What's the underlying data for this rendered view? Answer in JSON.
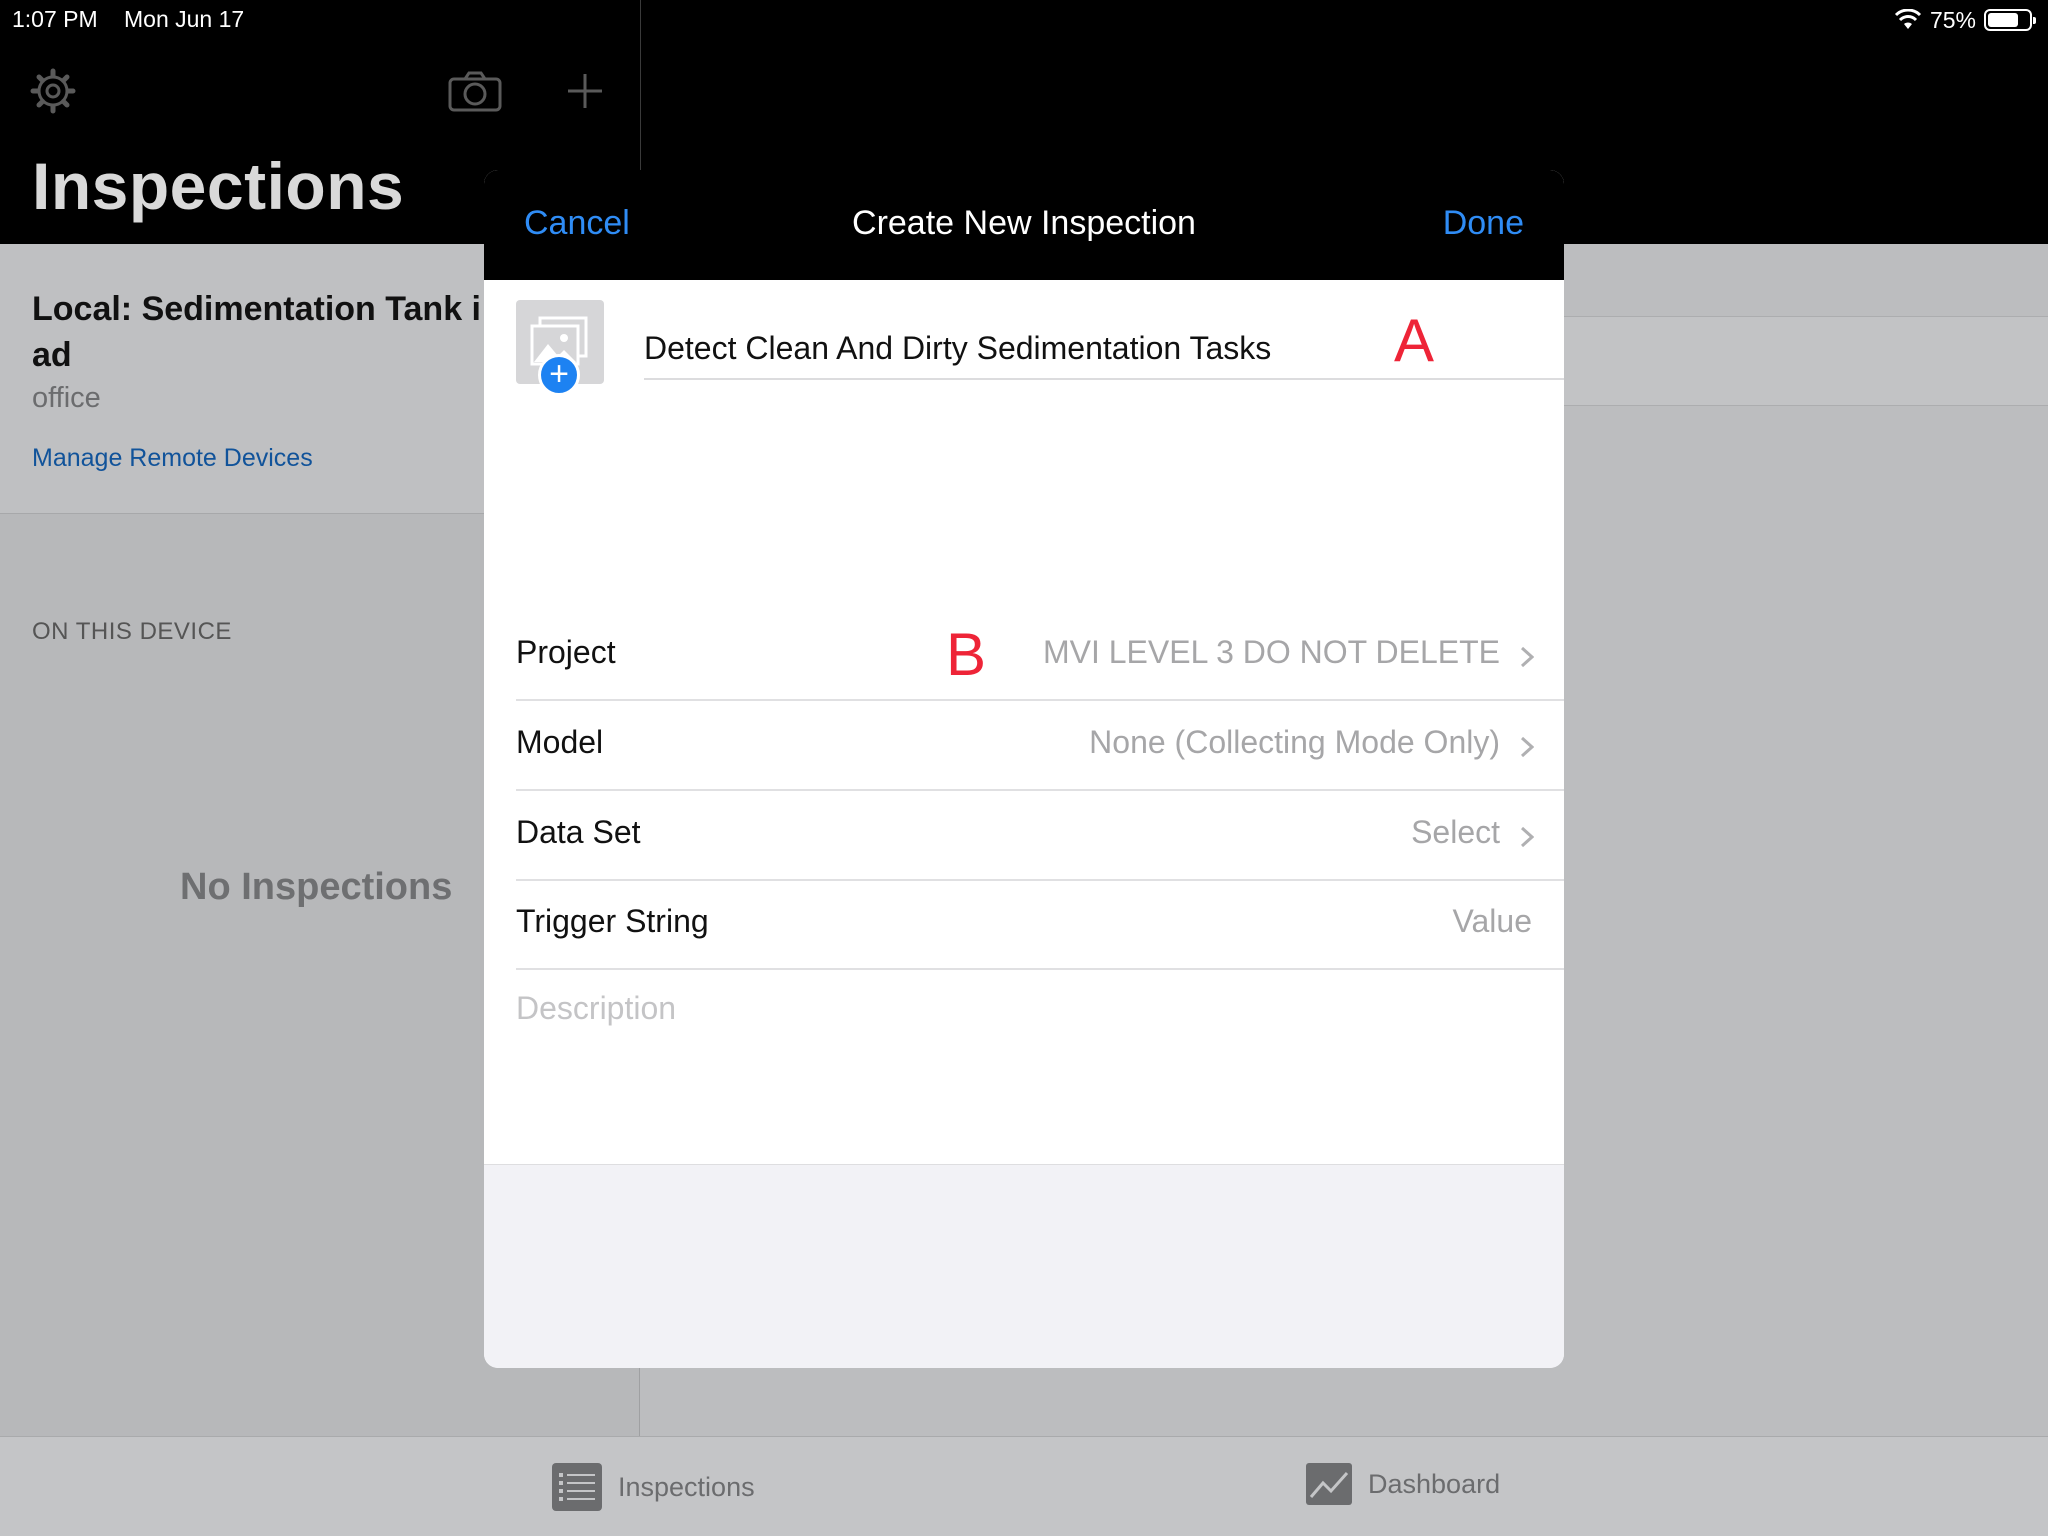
{
  "status_bar": {
    "time": "1:07 PM",
    "date": "Mon Jun 17",
    "battery": "75%",
    "battery_level": 0.75
  },
  "background": {
    "title": "Inspections",
    "device_name": "Local: Sedimentation Tank i\nad",
    "device_subtitle": "office",
    "manage_link": "Manage Remote Devices",
    "section_label": "ON THIS DEVICE",
    "empty_state": "No Inspections",
    "toolbar_icons": [
      "gear-icon",
      "camera-icon",
      "plus-icon"
    ]
  },
  "tab_bar": {
    "tabs": [
      {
        "label": "Inspections",
        "icon": "list-icon"
      },
      {
        "label": "Dashboard",
        "icon": "chart-icon"
      }
    ]
  },
  "modal": {
    "title": "Create New Inspection",
    "cancel_label": "Cancel",
    "done_label": "Done",
    "name_value": "Detect Clean And Dirty Sedimentation Tasks",
    "markers": {
      "a": "A",
      "b": "B"
    },
    "rows": [
      {
        "label": "Project",
        "value": "MVI LEVEL 3 DO NOT DELETE",
        "chevron": true
      },
      {
        "label": "Model",
        "value": "None (Collecting Mode Only)",
        "chevron": true
      },
      {
        "label": "Data Set",
        "value": "Select",
        "chevron": true
      },
      {
        "label": "Trigger String",
        "value": "Value",
        "chevron": false
      }
    ],
    "description_placeholder": "Description"
  },
  "colors": {
    "accent": "#2f8cf5",
    "marker": "#ee2437",
    "link": "#11539a"
  }
}
